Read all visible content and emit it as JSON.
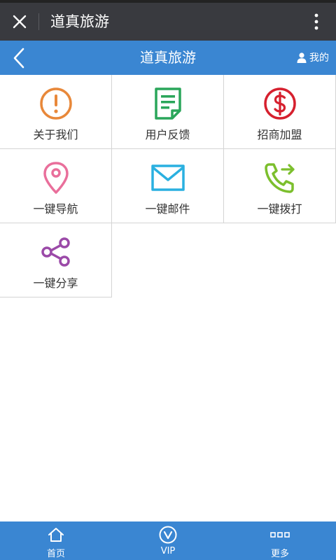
{
  "wechat_bar": {
    "title": "道真旅游",
    "close_icon": "close-icon",
    "more_icon": "more-vertical-icon"
  },
  "app_bar": {
    "title": "道真旅游",
    "back_icon": "chevron-left-icon",
    "mine_label": "我的",
    "mine_icon": "user-icon"
  },
  "grid": {
    "items": [
      {
        "label": "关于我们",
        "icon": "info-circle-icon",
        "color": "#e8883a"
      },
      {
        "label": "用户反馈",
        "icon": "document-feedback-icon",
        "color": "#2aa65a"
      },
      {
        "label": "招商加盟",
        "icon": "dollar-circle-icon",
        "color": "#d6202e"
      },
      {
        "label": "一键导航",
        "icon": "location-pin-icon",
        "color": "#e96f9b"
      },
      {
        "label": "一键邮件",
        "icon": "mail-icon",
        "color": "#2ab0e0"
      },
      {
        "label": "一键拨打",
        "icon": "phone-call-icon",
        "color": "#7cbf2d"
      },
      {
        "label": "一键分享",
        "icon": "share-icon",
        "color": "#9b4aa8"
      }
    ]
  },
  "tabbar": {
    "tabs": [
      {
        "label": "首页",
        "icon": "home-icon"
      },
      {
        "label": "VIP",
        "icon": "vip-icon"
      },
      {
        "label": "更多",
        "icon": "more-dots-icon"
      }
    ]
  },
  "colors": {
    "wechat_bar_bg": "#393a3f",
    "app_bar_bg": "#3a86d2",
    "tabbar_bg": "#3a86d2"
  }
}
